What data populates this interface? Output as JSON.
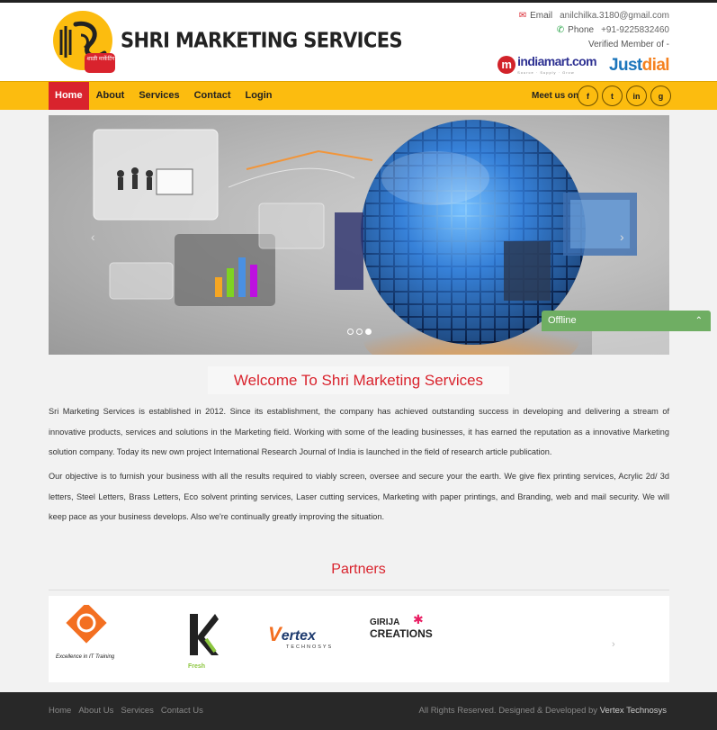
{
  "brand": {
    "name": "SHRI MARKETING SERVICES",
    "logo_text": "शाळी मार्केटिंग"
  },
  "contact": {
    "email_label": "Email",
    "email": "anilchilka.3180@gmail.com",
    "phone_label": "Phone",
    "phone": "+91-9225832460",
    "verified": "Verified Member of -"
  },
  "badges": {
    "indiamart_text": "indiamart.com",
    "indiamart_sub": "Source · Supply · Grow",
    "justdial_a": "Just",
    "justdial_b": "dial"
  },
  "nav": {
    "items": [
      {
        "label": "Home",
        "active": true
      },
      {
        "label": "About"
      },
      {
        "label": "Services"
      },
      {
        "label": "Contact"
      },
      {
        "label": "Login"
      }
    ],
    "meet_us": "Meet us on",
    "social": [
      "f",
      "t",
      "in",
      "g"
    ]
  },
  "slider": {
    "prev": "‹",
    "next": "›",
    "active_slide": 3,
    "slide_count": 3
  },
  "chat": {
    "status": "Offline",
    "chevron": "⌃"
  },
  "welcome": {
    "title": "Welcome To Shri Marketing Services",
    "p1": "Sri Marketing Services is established in 2012. Since its establishment, the company has achieved outstanding success in developing and delivering a stream of innovative products, services and solutions in the Marketing field. Working with some of the leading businesses, it has earned the reputation as a innovative Marketing solution company. Today its new own project International Research Journal of India is launched in the field of research article publication.",
    "p2": "Our objective is to furnish your business with all the results required to viably screen, oversee and secure your the earth. We give flex printing services, Acrylic 2d/ 3d letters, Steel Letters, Brass Letters, Eco solvent printing services, Laser cutting services, Marketing with paper printings, and Branding, web and mail security. We will keep pace as your business develops. Also we're continually greatly improving the situation."
  },
  "partners": {
    "title": "Partners",
    "logo1_caption": "Excellence in IT Training",
    "logo2_caption": "Fresh",
    "logo3_a": "ertex",
    "logo3_b": "TECHNOSYS",
    "logo4_a": "GIRIJA",
    "logo4_b": "CREATIONS",
    "next": "›"
  },
  "footer": {
    "links": [
      "Home",
      "About Us",
      "Services",
      "Contact Us"
    ],
    "copy": "All Rights Reserved. Designed & Developed by",
    "developer": "Vertex Technosys"
  },
  "colors": {
    "nav": "#fcbc0f",
    "accent": "#d9232d",
    "chat": "#6fae63",
    "footer": "#282828"
  }
}
